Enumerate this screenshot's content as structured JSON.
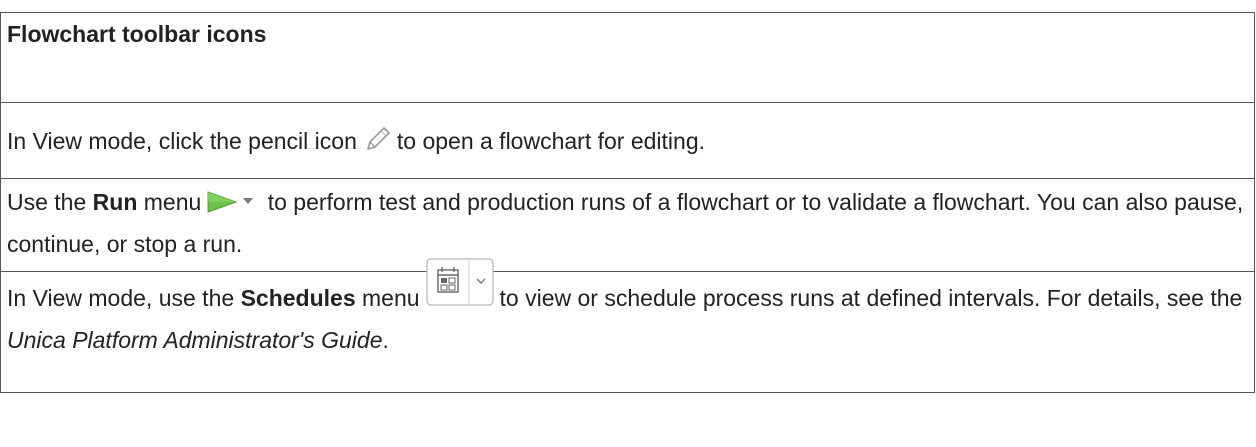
{
  "table": {
    "header": "Flowchart toolbar icons",
    "row1": {
      "before": "In View mode, click the pencil icon",
      "after": "to open a flowchart for editing.",
      "icon": "pencil-icon"
    },
    "row2": {
      "use": "Use the ",
      "menu": "Run",
      "menu_word": " menu",
      "after": "to perform test and production runs of a flowchart or to validate a flowchart. You can also pause, continue, or stop a run.",
      "icon": "run-play-dropdown-icon",
      "icon_color": "#6cc24a"
    },
    "row3": {
      "before": "In View mode, use the ",
      "menu": "Schedules",
      "menu_word": " menu",
      "after": "to view or schedule process runs at defined intervals. For details, see the ",
      "guide": "Unica Platform Administrator's Guide",
      "end": ".",
      "icon": "calendar-dropdown-icon"
    }
  }
}
